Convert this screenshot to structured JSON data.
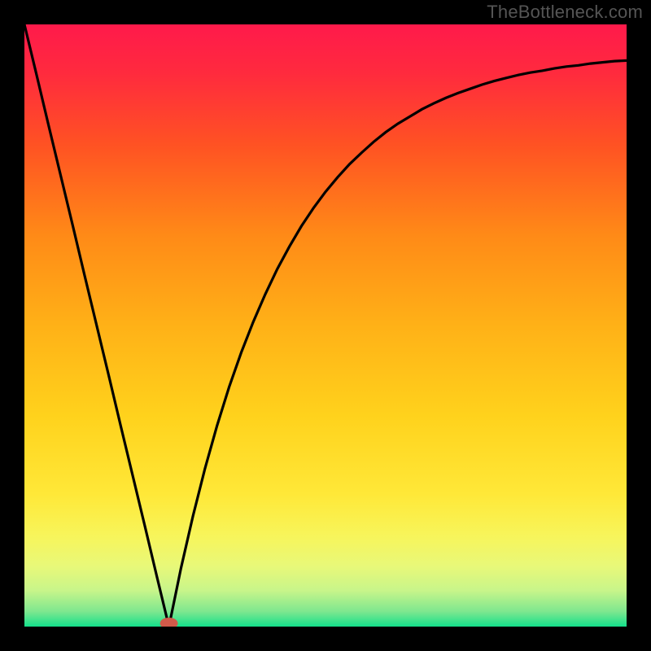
{
  "watermark": "TheBottleneck.com",
  "chart_data": {
    "type": "line",
    "title": "",
    "xlabel": "",
    "ylabel": "",
    "xlim": [
      0,
      100
    ],
    "ylim": [
      0,
      100
    ],
    "grid": false,
    "optimum_x": 24,
    "x": [
      0,
      2,
      4,
      6,
      8,
      10,
      12,
      14,
      16,
      18,
      20,
      22,
      24,
      26,
      28,
      30,
      32,
      34,
      36,
      38,
      40,
      42,
      44,
      46,
      48,
      50,
      52,
      54,
      56,
      58,
      60,
      62,
      64,
      66,
      68,
      70,
      72,
      74,
      76,
      78,
      80,
      82,
      84,
      86,
      88,
      90,
      92,
      94,
      96,
      98,
      100
    ],
    "values": [
      100.0,
      91.7,
      83.3,
      75.0,
      66.7,
      58.3,
      50.0,
      41.7,
      33.3,
      25.0,
      16.7,
      8.3,
      0.0,
      9.7,
      18.4,
      26.3,
      33.4,
      39.8,
      45.5,
      50.6,
      55.2,
      59.4,
      63.1,
      66.5,
      69.5,
      72.2,
      74.6,
      76.8,
      78.7,
      80.5,
      82.1,
      83.5,
      84.7,
      85.9,
      86.9,
      87.8,
      88.6,
      89.3,
      90.0,
      90.6,
      91.1,
      91.6,
      92.0,
      92.3,
      92.7,
      93.0,
      93.2,
      93.5,
      93.7,
      93.9,
      94.0
    ],
    "gradient_stops": [
      {
        "offset": 0.0,
        "color": "#ff1a4b"
      },
      {
        "offset": 0.08,
        "color": "#ff2a3e"
      },
      {
        "offset": 0.2,
        "color": "#ff5223"
      },
      {
        "offset": 0.35,
        "color": "#ff8a17"
      },
      {
        "offset": 0.5,
        "color": "#ffb117"
      },
      {
        "offset": 0.65,
        "color": "#ffd21c"
      },
      {
        "offset": 0.78,
        "color": "#ffe838"
      },
      {
        "offset": 0.85,
        "color": "#f7f55b"
      },
      {
        "offset": 0.9,
        "color": "#e8f879"
      },
      {
        "offset": 0.94,
        "color": "#c8f58a"
      },
      {
        "offset": 0.975,
        "color": "#7ee78f"
      },
      {
        "offset": 1.0,
        "color": "#14e08b"
      }
    ],
    "marker": {
      "x": 24,
      "y": 0,
      "color": "#d15a4a"
    }
  }
}
